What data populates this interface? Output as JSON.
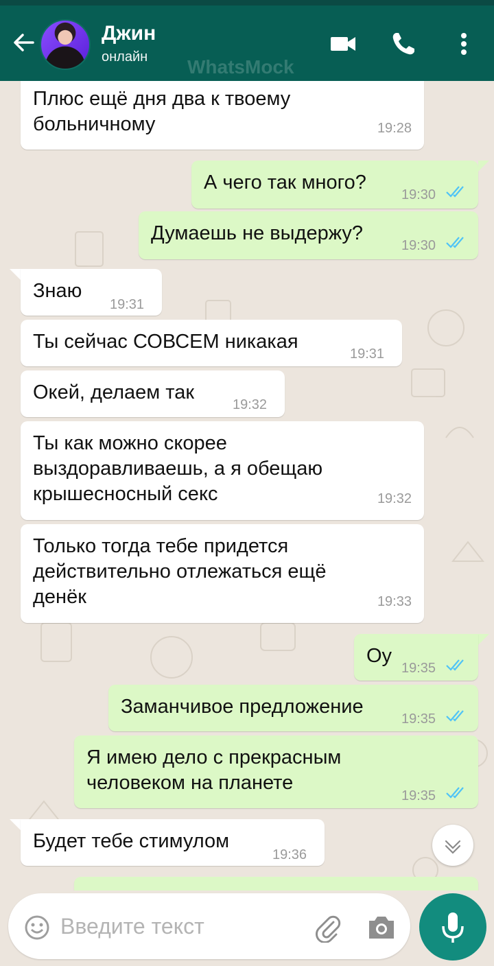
{
  "header": {
    "contact_name": "Джин",
    "contact_status": "онлайн",
    "watermark": "WhatsMock"
  },
  "messages": [
    {
      "direction": "in",
      "text": "Плюс ещё дня два к твоему\nбольничному",
      "time": "19:28"
    },
    {
      "direction": "out",
      "text": "А чего так много?",
      "time": "19:30",
      "read": true
    },
    {
      "direction": "out",
      "text": "Думаешь не выдержу?",
      "time": "19:30",
      "read": true
    },
    {
      "direction": "in",
      "text": "Знаю",
      "time": "19:31"
    },
    {
      "direction": "in",
      "text": "Ты сейчас СОВСЕМ никакая",
      "time": "19:31"
    },
    {
      "direction": "in",
      "text": "Окей, делаем так",
      "time": "19:32"
    },
    {
      "direction": "in",
      "text": "Ты как можно скорее\nвыздоравливаешь, а я обещаю\nкрышесносный секс",
      "time": "19:32"
    },
    {
      "direction": "in",
      "text": "Только тогда тебе придется\nдействительно отлежаться ещё\nденёк",
      "time": "19:33"
    },
    {
      "direction": "out",
      "text": "Оу",
      "time": "19:35",
      "read": true
    },
    {
      "direction": "out",
      "text": "Заманчивое предложение",
      "time": "19:35",
      "read": true
    },
    {
      "direction": "out",
      "text": "Я имею дело с прекрасным\nчеловеком на планете",
      "time": "19:35",
      "read": true
    },
    {
      "direction": "in",
      "text": "Будет тебе стимулом",
      "time": "19:36"
    }
  ],
  "composer": {
    "placeholder": "Введите текст"
  },
  "colors": {
    "header": "#075e54",
    "outgoing_bubble": "#dcf8c6",
    "incoming_bubble": "#ffffff",
    "read_ticks": "#4fc3f7",
    "mic_button": "#128c7e",
    "chat_background": "#ece5dd"
  },
  "icons": [
    "back-arrow-icon",
    "video-call-icon",
    "phone-icon",
    "more-vert-icon",
    "double-check-icon",
    "chevron-down-icon",
    "emoji-icon",
    "attach-icon",
    "camera-icon",
    "mic-icon"
  ]
}
